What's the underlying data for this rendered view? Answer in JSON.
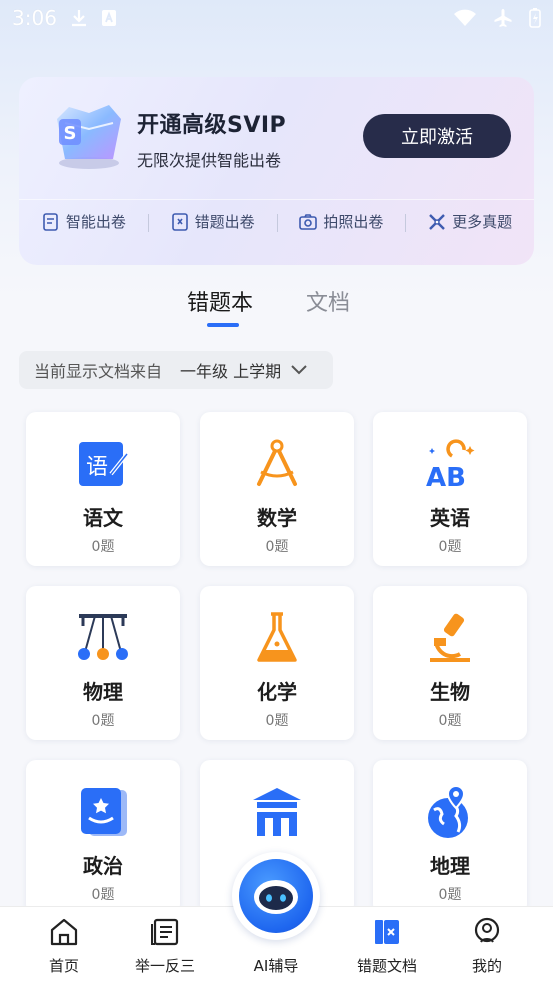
{
  "status_bar": {
    "time": "3:06"
  },
  "promo": {
    "title": "开通高级SVIP",
    "subtitle": "无限次提供智能出卷",
    "activate_label": "立即激活",
    "features": [
      {
        "label": "智能出卷",
        "icon": "paper-icon"
      },
      {
        "label": "错题出卷",
        "icon": "error-book-icon"
      },
      {
        "label": "拍照出卷",
        "icon": "camera-icon"
      },
      {
        "label": "更多真题",
        "icon": "pencil-ruler-icon"
      }
    ]
  },
  "tabs": [
    {
      "label": "错题本",
      "active": true
    },
    {
      "label": "文档",
      "active": false
    }
  ],
  "filter": {
    "prefix": "当前显示文档来自",
    "grade": "一年级 上学期"
  },
  "subjects": [
    {
      "name": "语文",
      "count": "0题",
      "icon": "chinese-icon"
    },
    {
      "name": "数学",
      "count": "0题",
      "icon": "compass-icon"
    },
    {
      "name": "英语",
      "count": "0题",
      "icon": "abc-icon"
    },
    {
      "name": "物理",
      "count": "0题",
      "icon": "newtons-cradle-icon"
    },
    {
      "name": "化学",
      "count": "0题",
      "icon": "flask-icon"
    },
    {
      "name": "生物",
      "count": "0题",
      "icon": "microscope-icon"
    },
    {
      "name": "政治",
      "count": "0题",
      "icon": "politics-book-icon"
    },
    {
      "name": "",
      "count": "",
      "icon": "history-building-icon"
    },
    {
      "name": "地理",
      "count": "0题",
      "icon": "globe-icon"
    }
  ],
  "bottom_nav": [
    {
      "label": "首页",
      "icon": "home-icon"
    },
    {
      "label": "举一反三",
      "icon": "document-list-icon"
    },
    {
      "label": "AI辅导",
      "icon": "robot-icon"
    },
    {
      "label": "错题文档",
      "icon": "error-doc-icon",
      "active": true
    },
    {
      "label": "我的",
      "icon": "profile-icon"
    }
  ],
  "colors": {
    "accent": "#2a6ef7",
    "orange": "#f7941d",
    "dark_button": "#272c4a"
  }
}
